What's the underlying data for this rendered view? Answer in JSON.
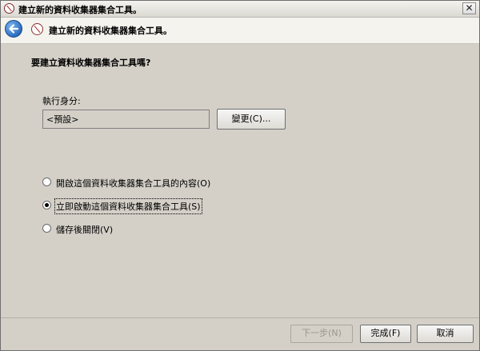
{
  "window": {
    "title": "建立新的資料收集器集合工具。",
    "close_symbol": "✕"
  },
  "header": {
    "title": "建立新的資料收集器集合工具。"
  },
  "main": {
    "question": "要建立資料收集器集合工具嗎?",
    "run_as_label": "執行身分:",
    "run_as_value": "<預設>",
    "change_button": "變更(C)...",
    "options": [
      {
        "label": "開啟這個資料收集器集合工具的內容(O)",
        "checked": false
      },
      {
        "label": "立即啟動這個資料收集器集合工具(S)",
        "checked": true
      },
      {
        "label": "儲存後關閉(V)",
        "checked": false
      }
    ]
  },
  "footer": {
    "next_label": "下一步(N)",
    "finish_label": "完成(F)",
    "cancel_label": "取消"
  }
}
